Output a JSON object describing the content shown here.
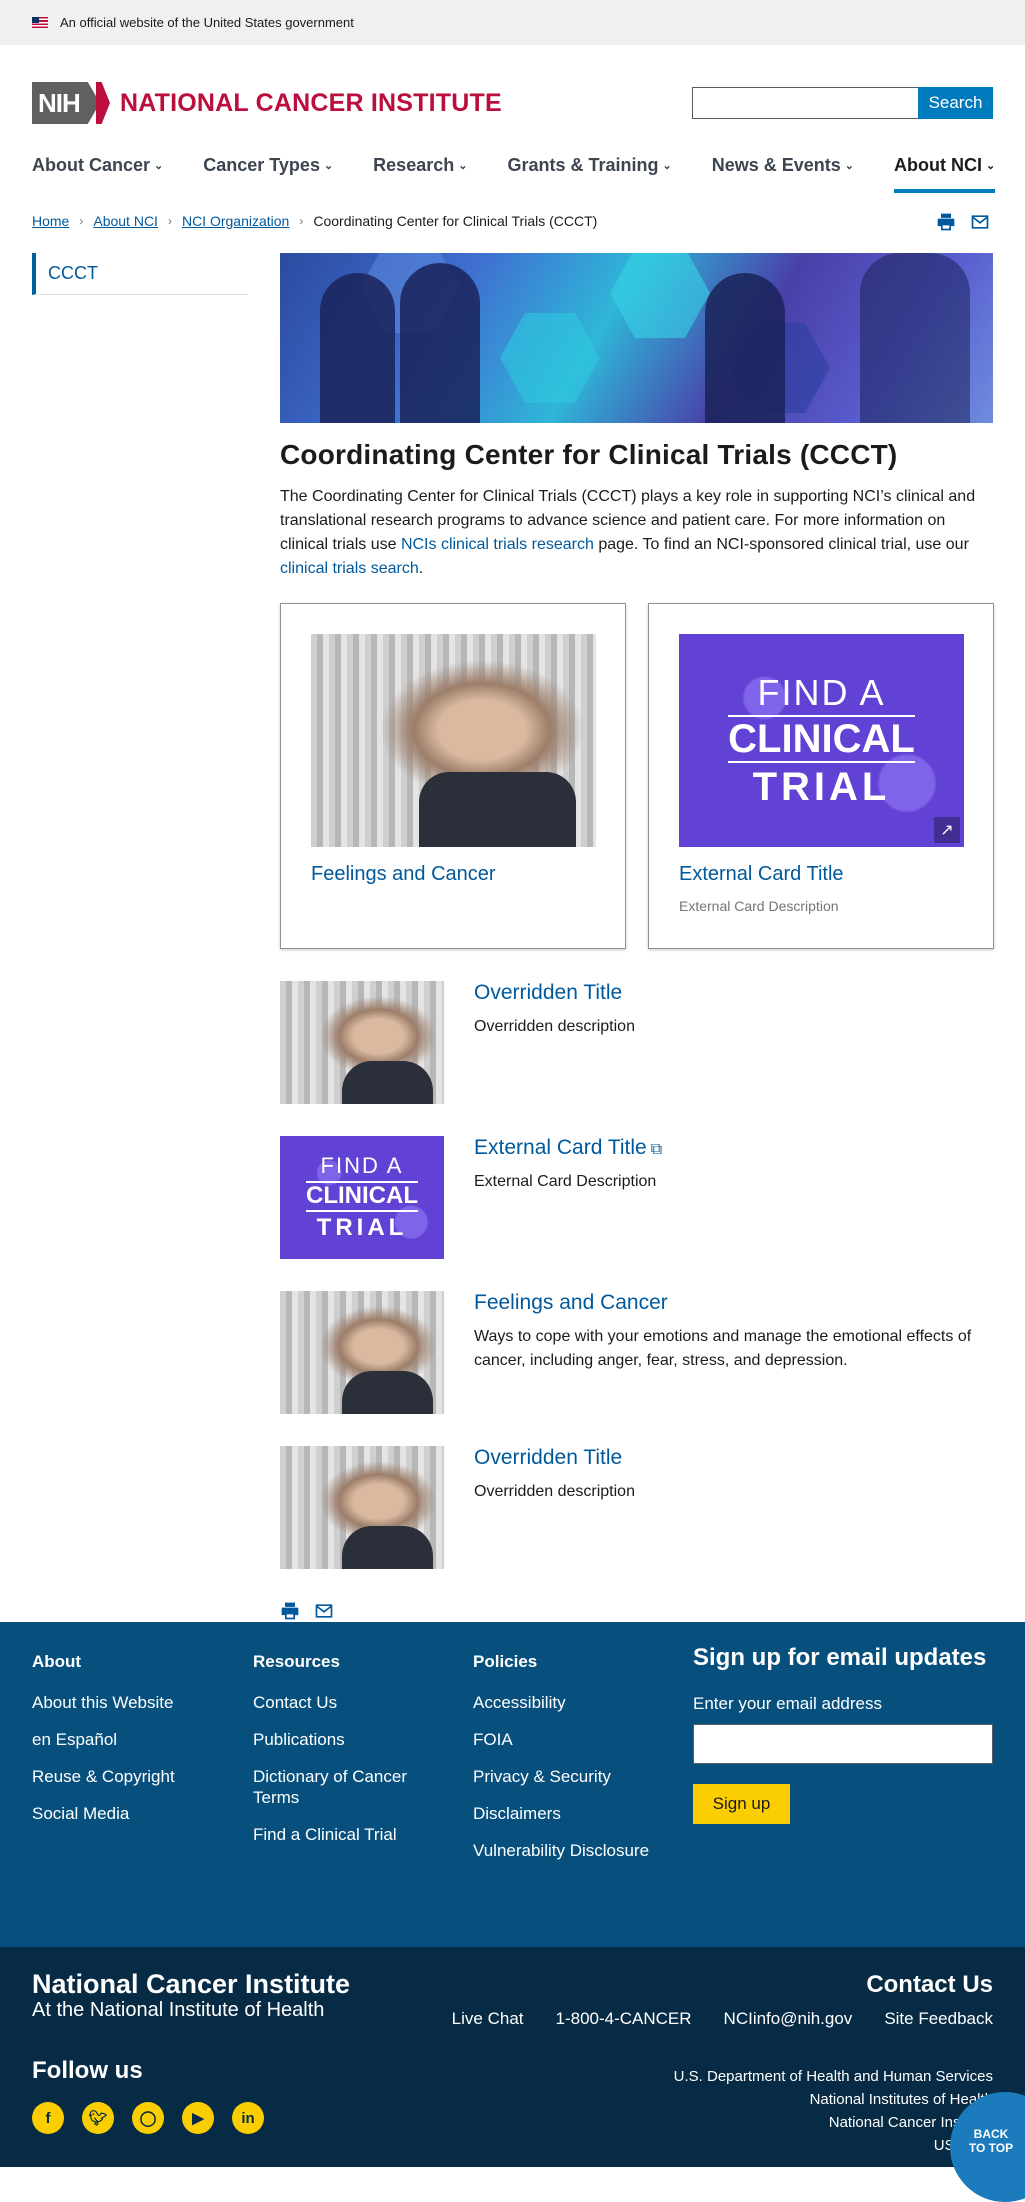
{
  "gov_banner": {
    "text": "An official website of the United States government"
  },
  "header": {
    "logo_short": "NIH",
    "logo_name": "NATIONAL CANCER INSTITUTE",
    "search_placeholder": "",
    "search_button": "Search"
  },
  "nav": [
    {
      "label": "About Cancer",
      "active": false
    },
    {
      "label": "Cancer Types",
      "active": false
    },
    {
      "label": "Research",
      "active": false
    },
    {
      "label": "Grants & Training",
      "active": false
    },
    {
      "label": "News & Events",
      "active": false
    },
    {
      "label": "About NCI",
      "active": true
    }
  ],
  "breadcrumb": [
    "Home",
    "About NCI",
    "NCI Organization",
    "Coordinating Center for Clinical Trials (CCCT)"
  ],
  "sidenav": {
    "item": "CCCT"
  },
  "page": {
    "title": "Coordinating Center for Clinical Trials (CCCT)",
    "intro_1": "The Coordinating Center for Clinical Trials (CCCT) plays a key role in supporting NCI’s clinical and translational research programs to advance science and patient care. For more information on clinical trials use ",
    "intro_link1": "NCIs clinical trials research",
    "intro_2": " page. To find an NCI-sponsored clinical trial, use our ",
    "intro_link2": "clinical trials search",
    "intro_3": "."
  },
  "cards": [
    {
      "title": "Feelings and Cancer",
      "description": ""
    },
    {
      "title": "External Card Title",
      "description": "External Card Description"
    }
  ],
  "trial_image": {
    "line1": "FIND A",
    "line2": "CLINICAL",
    "line3": "TRIAL"
  },
  "list": [
    {
      "title": "Overridden Title",
      "description": "Overridden description"
    },
    {
      "title": "External Card Title",
      "description": "External Card Description"
    },
    {
      "title": "Feelings and Cancer",
      "description": "Ways to cope with your emotions and manage the emotional effects of cancer, including anger, fear, stress, and depression."
    },
    {
      "title": "Overridden Title",
      "description": "Overridden description"
    }
  ],
  "footer": {
    "about": {
      "heading": "About",
      "links": [
        "About this Website",
        "en Español",
        "Reuse & Copyright",
        "Social Media"
      ]
    },
    "resources": {
      "heading": "Resources",
      "links": [
        "Contact Us",
        "Publications",
        "Dictionary of Cancer Terms",
        "Find a Clinical Trial"
      ]
    },
    "policies": {
      "heading": "Policies",
      "links": [
        "Accessibility",
        "FOIA",
        "Privacy & Security",
        "Disclaimers",
        "Vulnerability Disclosure"
      ]
    },
    "signup": {
      "heading": "Sign up for email updates",
      "label": "Enter your email address",
      "button": "Sign up"
    }
  },
  "subfooter": {
    "title": "National Cancer Institute",
    "subtitle": "At the National Institute of Health",
    "follow": "Follow us",
    "social": [
      "facebook-icon",
      "twitter-icon",
      "instagram-icon",
      "youtube-icon",
      "linkedin-icon"
    ],
    "contact_heading": "Contact Us",
    "contact_links": [
      "Live Chat",
      "1-800-4-CANCER",
      "NCIinfo@nih.gov",
      "Site Feedback"
    ],
    "agencies": [
      "U.S. Department of Health and Human Services",
      "National Institutes of Health",
      "National Cancer Institute",
      "USA.gov"
    ],
    "back_to_top": "BACK TO TOP"
  },
  "colors": {
    "brand_red": "#bb0e3d",
    "link_blue": "#00599c",
    "footer_blue": "#07507d",
    "subfooter_navy": "#072b44",
    "accent_yellow": "#face00"
  }
}
